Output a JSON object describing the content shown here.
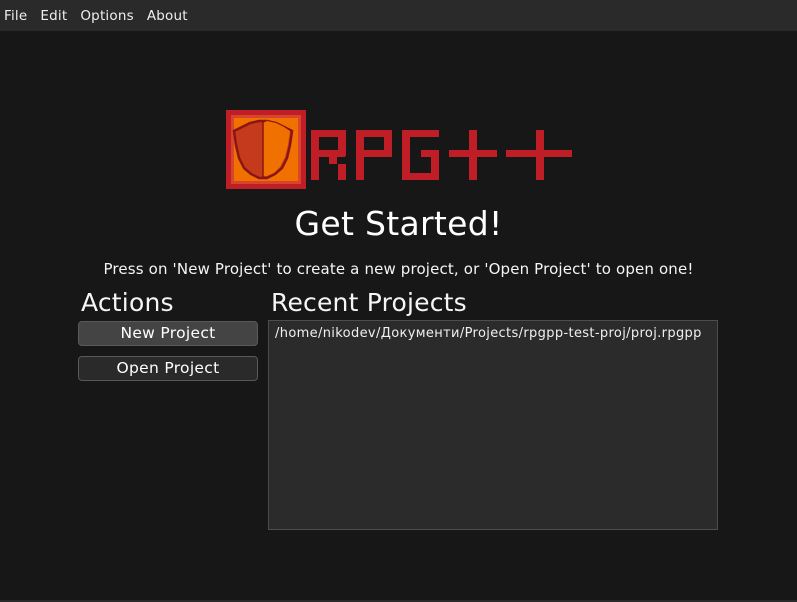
{
  "menubar": {
    "items": [
      {
        "label": "File"
      },
      {
        "label": "Edit"
      },
      {
        "label": "Options"
      },
      {
        "label": "About"
      }
    ]
  },
  "logo": {
    "text": "RPG++",
    "icon": "shield-icon",
    "colors": {
      "frame": "#bf1e26",
      "fill": "#f07000",
      "text": "#bf1e26"
    }
  },
  "welcome": {
    "title": "Get Started!",
    "subtitle": "Press on 'New Project' to create a new project, or 'Open Project' to open one!"
  },
  "actions": {
    "title": "Actions",
    "new_project_label": "New Project",
    "open_project_label": "Open Project"
  },
  "recent": {
    "title": "Recent Projects",
    "items": [
      {
        "path": "/home/nikodev/Документи/Projects/rpgpp-test-proj/proj.rpgpp"
      }
    ]
  }
}
